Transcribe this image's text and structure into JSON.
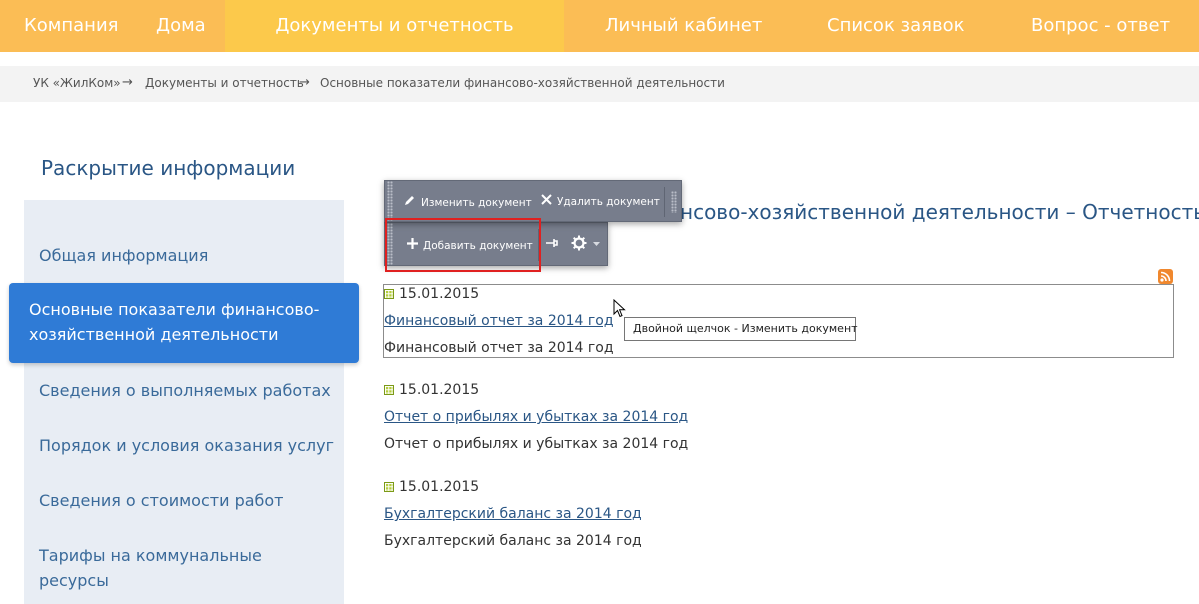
{
  "topnav": {
    "items": [
      "Компания",
      "Дома",
      "Документы и отчетность",
      "Личный кабинет",
      "Список заявок",
      "Вопрос - ответ"
    ],
    "active_index": 2
  },
  "breadcrumb": {
    "items": [
      "УК «ЖилКом»",
      "Документы и отчетность",
      "Основные показатели финансово-хозяйственной деятельности"
    ],
    "separator": "→"
  },
  "sidebar": {
    "title": "Раскрытие информации",
    "items": [
      "Общая информация",
      "Основные показатели финансово-хозяйственной деятельности",
      "Сведения о выполняемых работах",
      "Порядок и условия оказания услуг",
      "Сведения о стоимости работ",
      "Тарифы на коммунальные ресурсы"
    ],
    "active_index": 1
  },
  "main": {
    "title_visible": "нсово-хозяйственной деятельности – Отчетность"
  },
  "toolbar": {
    "edit_label": "Изменить документ",
    "delete_label": "Удалить документ",
    "add_label": "Добавить документ",
    "icons": [
      "pencil-icon",
      "cross-icon",
      "plus-icon",
      "pin-icon",
      "gear-icon",
      "dropdown-arrow-icon"
    ]
  },
  "tooltip": "Двойной щелчок - Изменить документ",
  "documents": [
    {
      "date": "15.01.2015",
      "title": "Финансовый отчет за 2014 год",
      "description": "Финансовый отчет за 2014 год"
    },
    {
      "date": "15.01.2015",
      "title": "Отчет о прибылях и убытках за 2014 год",
      "description": "Отчет о прибылях и убытках за 2014 год"
    },
    {
      "date": "15.01.2015",
      "title": "Бухгалтерский баланс за 2014 год",
      "description": "Бухгалтерский баланс за 2014 год"
    }
  ],
  "colors": {
    "nav": "#fbbd55",
    "nav_active": "#fcc94b",
    "sidebar_active": "#2f7bd6",
    "sidebar_bg": "#e8edf4",
    "heading": "#2a5685",
    "highlight": "#e02020",
    "rss": "#f0882e"
  }
}
